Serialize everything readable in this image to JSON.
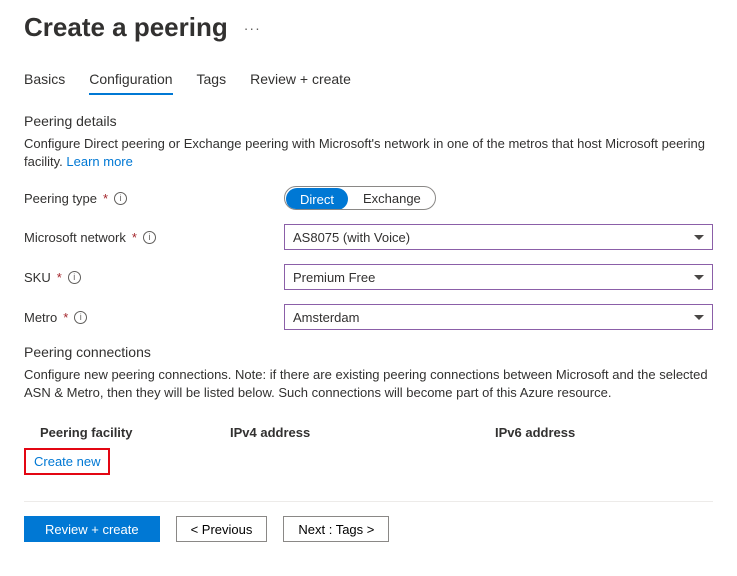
{
  "header": {
    "title": "Create a peering"
  },
  "tabs": [
    "Basics",
    "Configuration",
    "Tags",
    "Review + create"
  ],
  "details": {
    "title": "Peering details",
    "desc": "Configure Direct peering or Exchange peering with Microsoft's network in one of the metros that host Microsoft peering facility. ",
    "learn": "Learn more"
  },
  "form": {
    "peering_type": {
      "label": "Peering type",
      "opt1": "Direct",
      "opt2": "Exchange"
    },
    "network": {
      "label": "Microsoft network",
      "value": "AS8075 (with Voice)"
    },
    "sku": {
      "label": "SKU",
      "value": "Premium Free"
    },
    "metro": {
      "label": "Metro",
      "value": "Amsterdam"
    }
  },
  "connections": {
    "title": "Peering connections",
    "desc": "Configure new peering connections. Note: if there are existing peering connections between Microsoft and the selected ASN & Metro, then they will be listed below. Such connections will become part of this Azure resource.",
    "columns": [
      "Peering facility",
      "IPv4 address",
      "IPv6 address"
    ],
    "create_new": "Create new"
  },
  "footer": {
    "review": "Review + create",
    "previous": "< Previous",
    "next": "Next : Tags >"
  }
}
